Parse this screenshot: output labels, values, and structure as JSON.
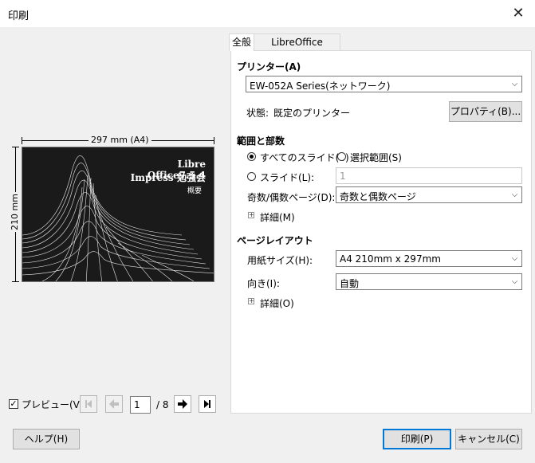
{
  "window": {
    "title": "印刷"
  },
  "tabs": [
    {
      "label": "全般"
    },
    {
      "label": "LibreOffice Impress"
    }
  ],
  "printer": {
    "section_label": "プリンター(A)",
    "selected": "EW-052A Series(ネットワーク)",
    "status_label": "状態:",
    "status_value": "既定のプリンター",
    "properties_button": "プロパティ(B)..."
  },
  "range": {
    "section_label": "範囲と部数",
    "all_slides": "すべてのスライド(S)",
    "selection": "選択範囲(S)",
    "slides": "スライド(L):",
    "slides_value": "1",
    "odd_even_label": "奇数/偶数ページ(D):",
    "odd_even_value": "奇数と偶数ページ",
    "details": "詳細(M)"
  },
  "layout": {
    "section_label": "ページレイアウト",
    "paper_label": "用紙サイズ(H):",
    "paper_value": "A4 210mm x 297mm",
    "orientation_label": "向き(I):",
    "orientation_value": "自動",
    "details": "詳細(O)"
  },
  "preview": {
    "width_label": "297 mm (A4)",
    "height_label": "210 mm",
    "slide_title_line1": "Libre Office7.5.4",
    "slide_title_line2": "Impress 勉強会",
    "slide_subtitle": "概要",
    "checkbox_label": "プレビュー(V)",
    "page_value": "1",
    "page_total": "/ 8",
    "checkbox_checked": true
  },
  "footer": {
    "help": "ヘルプ(H)",
    "print": "印刷(P)",
    "cancel": "キャンセル(C)"
  },
  "icons": {
    "close": "close-icon",
    "first": "first-page-icon",
    "prev": "prev-page-icon",
    "next": "next-page-icon",
    "last": "last-page-icon",
    "dropdown": "chevron-down-icon",
    "expand": "plus-icon"
  }
}
